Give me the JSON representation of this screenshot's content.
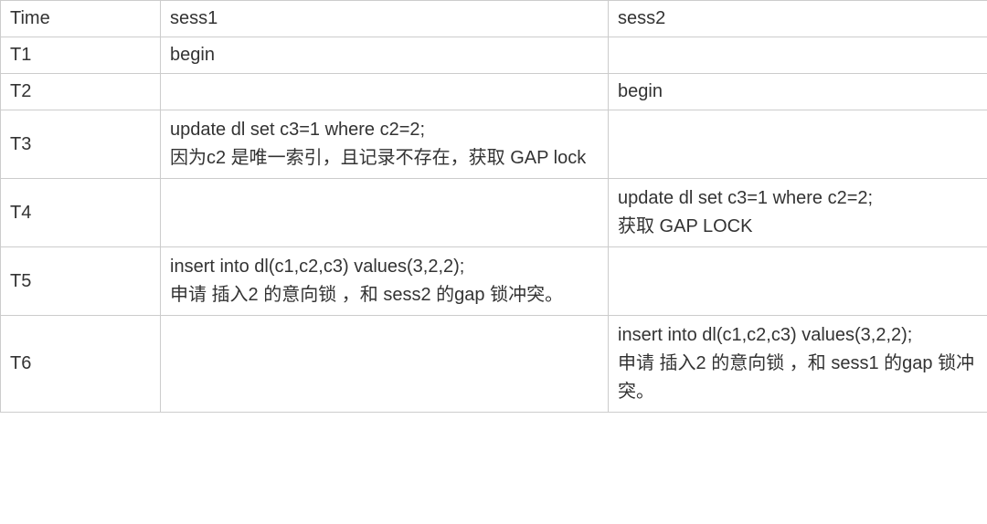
{
  "headers": {
    "time": "Time",
    "sess1": "sess1",
    "sess2": "sess2"
  },
  "rows": [
    {
      "time": "T1",
      "sess1": "begin",
      "sess2": ""
    },
    {
      "time": "T2",
      "sess1": "",
      "sess2": "begin"
    },
    {
      "time": "T3",
      "sess1": "update dl set c3=1 where c2=2;\n因为c2 是唯一索引，且记录不存在，获取 GAP lock",
      "sess2": ""
    },
    {
      "time": "T4",
      "sess1": "",
      "sess2": "update dl set c3=1 where c2=2;\n获取 GAP LOCK"
    },
    {
      "time": "T5",
      "sess1": "insert into dl(c1,c2,c3) values(3,2,2);\n申请 插入2 的意向锁 ，和 sess2 的gap 锁冲突。",
      "sess2": ""
    },
    {
      "time": "T6",
      "sess1": "",
      "sess2": "insert into dl(c1,c2,c3) values(3,2,2);\n申请 插入2 的意向锁 ，和 sess1 的gap 锁冲突。"
    }
  ]
}
